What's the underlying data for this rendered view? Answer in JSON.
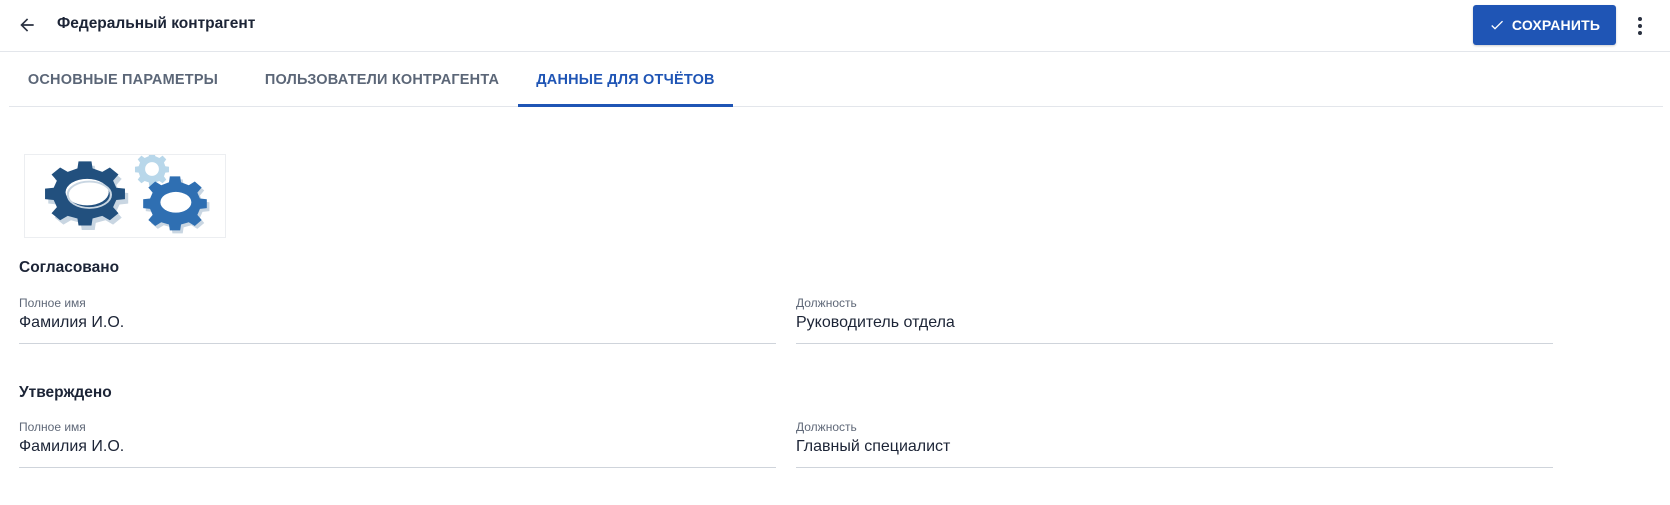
{
  "header": {
    "title": "Федеральный контрагент",
    "save_label": "СОХРАНИТЬ",
    "back_icon": "arrow-left-icon",
    "more_icon": "more-vertical-icon"
  },
  "tabs": [
    {
      "label": "ОСНОВНЫЕ ПАРАМЕТРЫ",
      "active": false
    },
    {
      "label": "ПОЛЬЗОВАТЕЛИ КОНТРАГЕНТА",
      "active": false
    },
    {
      "label": "ДАННЫЕ ДЛЯ ОТЧЁТОВ",
      "active": true
    }
  ],
  "logo": {
    "icon": "gears-logo-image"
  },
  "approved_section": {
    "title": "Согласовано",
    "full_name": {
      "label": "Полное имя",
      "value": "Фамилия И.О."
    },
    "position": {
      "label": "Должность",
      "value": "Руководитель отдела"
    }
  },
  "confirmed_section": {
    "title": "Утверждено",
    "full_name": {
      "label": "Полное имя",
      "value": "Фамилия И.О."
    },
    "position": {
      "label": "Должность",
      "value": "Главный специалист"
    }
  },
  "colors": {
    "accent": "#1f55b5",
    "text": "#1c2436",
    "muted": "#5b6677",
    "divider": "#e3e6eb"
  }
}
